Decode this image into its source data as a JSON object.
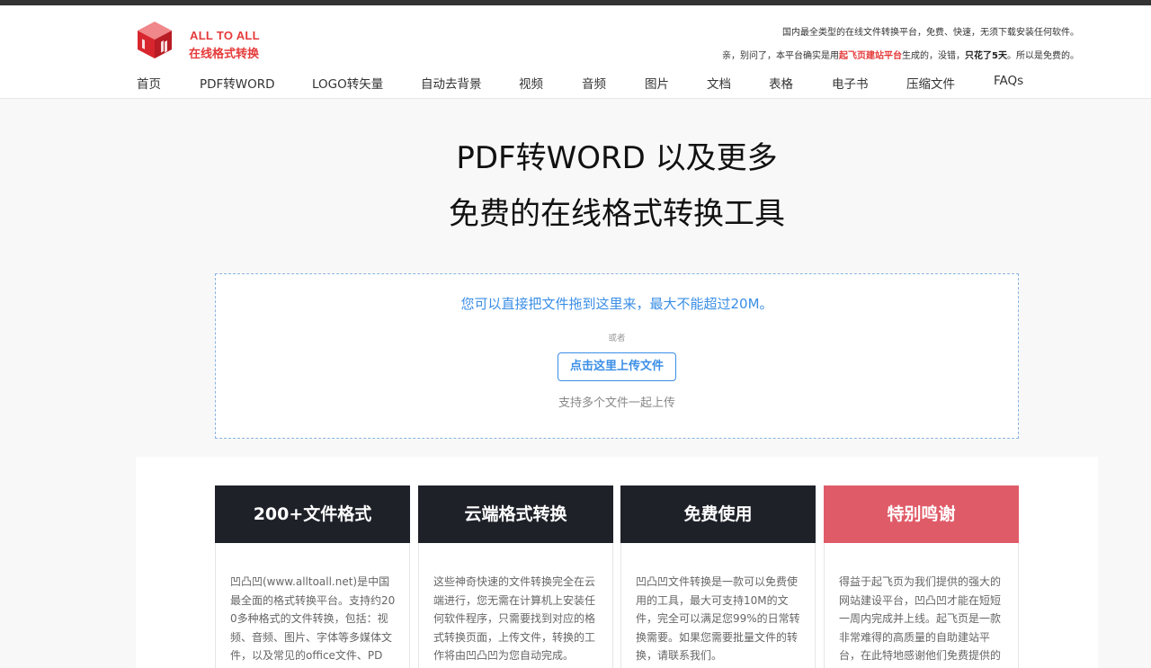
{
  "brand": {
    "name_en": "ALL TO ALL",
    "name_cn": "在线格式转换",
    "logo_icon": "cube-logo-icon"
  },
  "header": {
    "tagline": "国内最全类型的在线文件转换平台，免费、快速，无须下载安装任何软件。",
    "credit_prefix": "亲，别问了，本平台确实是用",
    "credit_link": "起飞页建站平台",
    "credit_mid": "生成的，没错，",
    "credit_bold": "只花了5天",
    "credit_suffix": "。所以是免费的。"
  },
  "nav": [
    "首页",
    "PDF转WORD",
    "LOGO转矢量",
    "自动去背景",
    "视频",
    "音频",
    "图片",
    "文档",
    "表格",
    "电子书",
    "压缩文件",
    "FAQs"
  ],
  "hero": {
    "line1": "PDF转WORD 以及更多",
    "line2": "免费的在线格式转换工具"
  },
  "dropzone": {
    "main_text": "您可以直接把文件拖到这里来，最大不能超过20M。",
    "or_text": "或者",
    "button_label": "点击这里上传文件",
    "multi_text": "支持多个文件一起上传",
    "accent_color": "#3a8ee6"
  },
  "features": [
    {
      "title": "200+文件格式",
      "body": "凹凸凹(www.alltoall.net)是中国最全面的格式转换平台。支持约200多种格式的文件转换，包括：视频、音频、图片、字体等多媒体文件，以及常见的office文件、PDF、"
    },
    {
      "title": "云端格式转换",
      "body": "这些神奇快速的文件转换完全在云端进行，您无需在计算机上安装任何软件程序，只需要找到对应的格式转换页面，上传文件，转换的工作将由凹凸凹为您自动完成。"
    },
    {
      "title": "免费使用",
      "body": "凹凸凹文件转换是一款可以免费使用的工具，最大可支持10M的文件，完全可以满足您99%的日常转换需要。如果您需要批量文件的转换，请联系我们。"
    },
    {
      "title": "特别鸣谢",
      "body": "得益于起飞页为我们提供的强大的网站建设平台，凹凸凹才能在短短一周内完成并上线。起飞页是一款非常难得的高质量的自助建站平台，在此特地感谢他们免费提供的"
    }
  ],
  "colors": {
    "brand_red": "#e53a3a",
    "card_dark": "#1f2129",
    "card_red": "#e05b68"
  }
}
